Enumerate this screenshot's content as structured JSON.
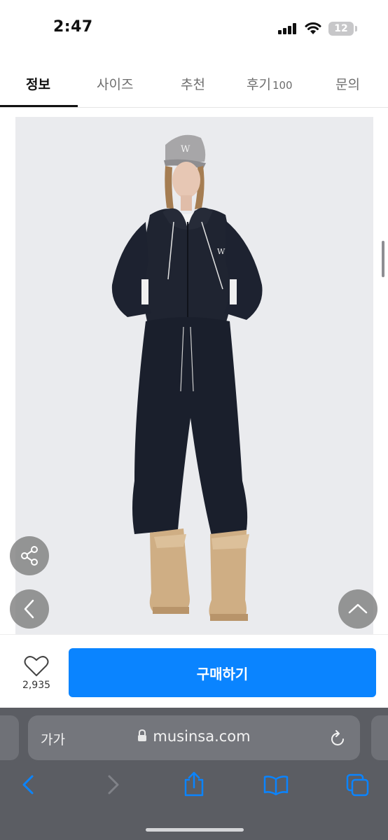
{
  "status_bar": {
    "time": "2:47",
    "battery": "12"
  },
  "tabs": [
    {
      "label": "정보",
      "active": true
    },
    {
      "label": "사이즈",
      "active": false
    },
    {
      "label": "추천",
      "active": false
    },
    {
      "label": "후기",
      "count": "100",
      "active": false
    },
    {
      "label": "문의",
      "active": false
    }
  ],
  "purchase": {
    "like_count": "2,935",
    "buy_label": "구매하기"
  },
  "safari": {
    "text_size_label": "가가",
    "url": "musinsa.com"
  },
  "colors": {
    "accent": "#0a84ff",
    "toolbar_icon": "#0a84ff",
    "safari_bg": "#5b5d63"
  },
  "icons": {
    "share": "share-icon",
    "back": "chevron-left-icon",
    "top": "chevron-up-icon",
    "like": "heart-icon",
    "lock": "lock-icon",
    "reload": "reload-icon",
    "nav_back": "back-icon",
    "nav_forward": "forward-icon",
    "share_sheet": "share-sheet-icon",
    "bookmarks": "book-icon",
    "tabs": "tabs-icon"
  }
}
